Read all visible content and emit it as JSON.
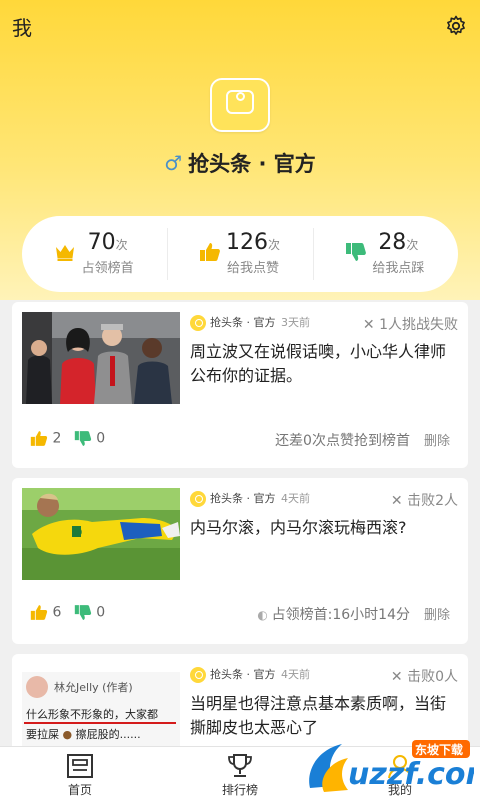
{
  "header": {
    "title": "我",
    "profile_name": "抢头条 · 官方",
    "gender_symbol": "♂"
  },
  "stats": [
    {
      "value": "70",
      "unit": "次",
      "label": "占领榜首",
      "icon": "crown-icon"
    },
    {
      "value": "126",
      "unit": "次",
      "label": "给我点赞",
      "icon": "thumbs-up-icon"
    },
    {
      "value": "28",
      "unit": "次",
      "label": "给我点踩",
      "icon": "thumbs-down-icon"
    }
  ],
  "cards": [
    {
      "author": "抢头条 · 官方",
      "time": "3天前",
      "status": "1人挑战失败",
      "headline": "周立波又在说假话噢，小心华人律师公布你的证据。",
      "likes": "2",
      "dislikes": "0",
      "info": "还差0次点赞抢到榜首",
      "delete_label": "删除"
    },
    {
      "author": "抢头条 · 官方",
      "time": "4天前",
      "status": "击败2人",
      "headline": "内马尔滚，内马尔滚玩梅西滚?",
      "likes": "6",
      "dislikes": "0",
      "info": "占领榜首:16小时14分",
      "delete_label": "删除"
    },
    {
      "author": "抢头条 · 官方",
      "time": "4天前",
      "status": "击败0人",
      "headline": "当明星也得注意点基本素质啊，当街撕脚皮也太恶心了",
      "thumb_user": "林允Jelly (作者)",
      "thumb_line1": "什么形象不形象的，大家都",
      "thumb_line2": "要拉屎",
      "thumb_line3": "擦屁股的......"
    }
  ],
  "tabbar": {
    "items": [
      {
        "label": "首页",
        "icon": "home-icon"
      },
      {
        "label": "排行榜",
        "icon": "trophy-icon"
      },
      {
        "label": "我的",
        "icon": "profile-icon"
      }
    ]
  },
  "watermark": {
    "brand": "uzzf.com",
    "top_text": "东坡下载"
  },
  "colors": {
    "accent": "#ffd83a",
    "like": "#f5b800",
    "dislike": "#3dbb7a"
  }
}
